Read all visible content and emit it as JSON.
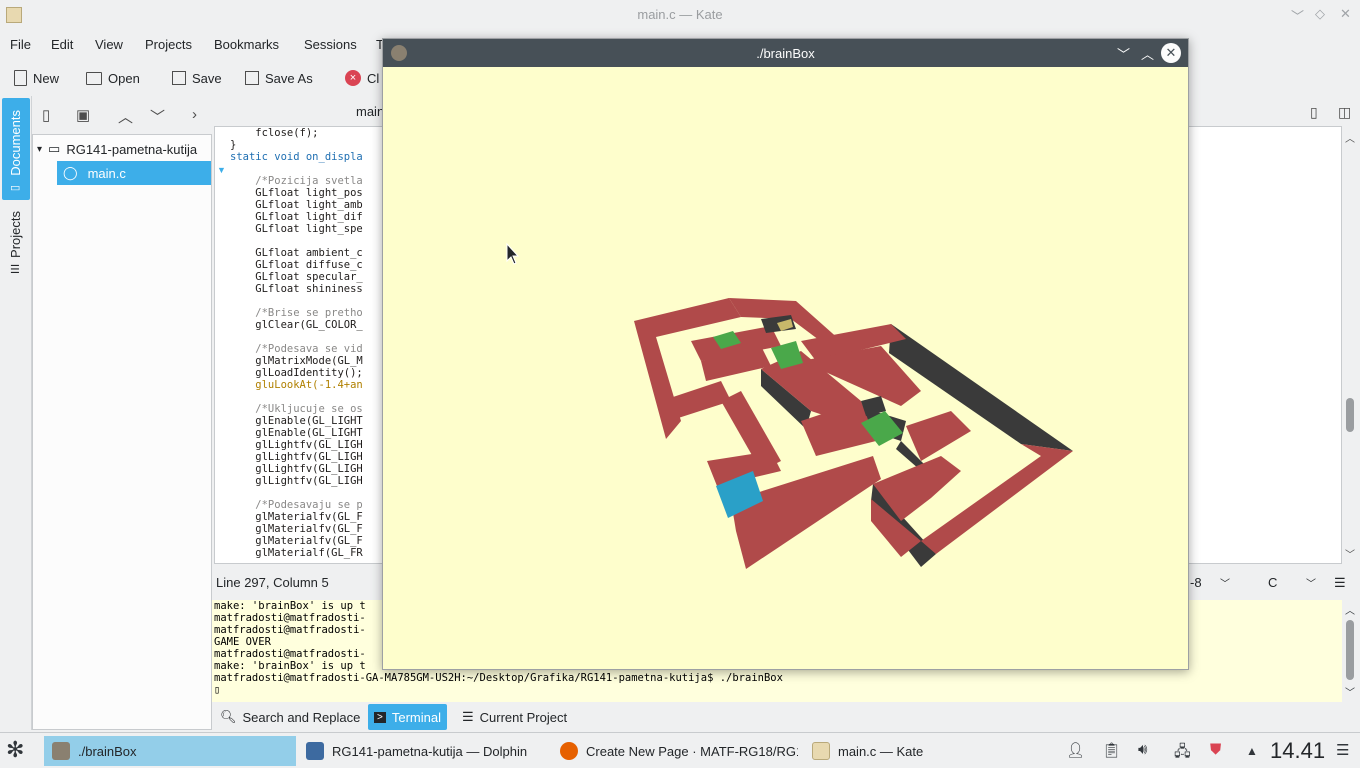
{
  "kate": {
    "title": "main.c  — Kate",
    "menu": [
      "File",
      "Edit",
      "View",
      "Projects",
      "Bookmarks",
      "Sessions",
      "T"
    ],
    "toolbar": {
      "new": "New",
      "open": "Open",
      "save": "Save",
      "save_as": "Save As",
      "close": "Cl"
    },
    "side_tabs": [
      "Documents",
      "Projects"
    ],
    "tree": {
      "folder": "RG141-pametna-kutija",
      "file": "main.c"
    },
    "editor_tab": "main",
    "status": {
      "position": "Line 297, Column 5",
      "encoding": "-8",
      "mode": "C"
    },
    "code": [
      {
        "t": "    fclose(f);",
        "c": ""
      },
      {
        "t": "}",
        "c": ""
      },
      {
        "t": "static void on_displa",
        "c": "kw"
      },
      {
        "t": "",
        "c": ""
      },
      {
        "t": "    /*Pozicija svetla",
        "c": "cm"
      },
      {
        "t": "    GLfloat light_pos",
        "c": ""
      },
      {
        "t": "    GLfloat light_amb",
        "c": ""
      },
      {
        "t": "    GLfloat light_dif",
        "c": ""
      },
      {
        "t": "    GLfloat light_spe",
        "c": ""
      },
      {
        "t": "",
        "c": ""
      },
      {
        "t": "    GLfloat ambient_c",
        "c": ""
      },
      {
        "t": "    GLfloat diffuse_c",
        "c": ""
      },
      {
        "t": "    GLfloat specular_",
        "c": ""
      },
      {
        "t": "    GLfloat shininess",
        "c": ""
      },
      {
        "t": "",
        "c": ""
      },
      {
        "t": "    /*Brise se pretho",
        "c": "cm"
      },
      {
        "t": "    glClear(GL_COLOR_",
        "c": ""
      },
      {
        "t": "",
        "c": ""
      },
      {
        "t": "    /*Podesava se vid",
        "c": "cm"
      },
      {
        "t": "    glMatrixMode(GL_M",
        "c": ""
      },
      {
        "t": "    glLoadIdentity();",
        "c": ""
      },
      {
        "t": "    gluLookAt(-1.4+an",
        "c": "num"
      },
      {
        "t": "",
        "c": ""
      },
      {
        "t": "    /*Ukljucuje se os",
        "c": "cm"
      },
      {
        "t": "    glEnable(GL_LIGHT",
        "c": ""
      },
      {
        "t": "    glEnable(GL_LIGHT",
        "c": ""
      },
      {
        "t": "    glLightfv(GL_LIGH",
        "c": ""
      },
      {
        "t": "    glLightfv(GL_LIGH",
        "c": ""
      },
      {
        "t": "    glLightfv(GL_LIGH",
        "c": ""
      },
      {
        "t": "    glLightfv(GL_LIGH",
        "c": ""
      },
      {
        "t": "",
        "c": ""
      },
      {
        "t": "    /*Podesavaju se p",
        "c": "cm"
      },
      {
        "t": "    glMaterialfv(GL_F",
        "c": ""
      },
      {
        "t": "    glMaterialfv(GL_F",
        "c": ""
      },
      {
        "t": "    glMaterialfv(GL_F",
        "c": ""
      },
      {
        "t": "    glMaterialf(GL_FR",
        "c": ""
      }
    ],
    "terminal": [
      "make: 'brainBox' is up t",
      "matfradosti@matfradosti-",
      "matfradosti@matfradosti-",
      "GAME OVER",
      "matfradosti@matfradosti-",
      "make: 'brainBox' is up t",
      "matfradosti@matfradosti-GA-MA785GM-US2H:~/Desktop/Grafika/RG141-pametna-kutija$ ./brainBox",
      "▯"
    ],
    "bottom_tabs": {
      "search": "Search and Replace",
      "terminal": "Terminal",
      "project": "Current Project"
    }
  },
  "brainbox": {
    "title": "./brainBox"
  },
  "taskbar": {
    "tasks": [
      "./brainBox",
      "RG141-pametna-kutija — Dolphin",
      "Create New Page · MATF-RG18/RG1",
      "main.c  — Kate"
    ],
    "clock": "14.41"
  },
  "colors": {
    "accent": "#3daee9",
    "wall": "#b04a4a",
    "floor": "#fefecc",
    "green": "#4aa84a",
    "blue": "#2aa0c8"
  }
}
